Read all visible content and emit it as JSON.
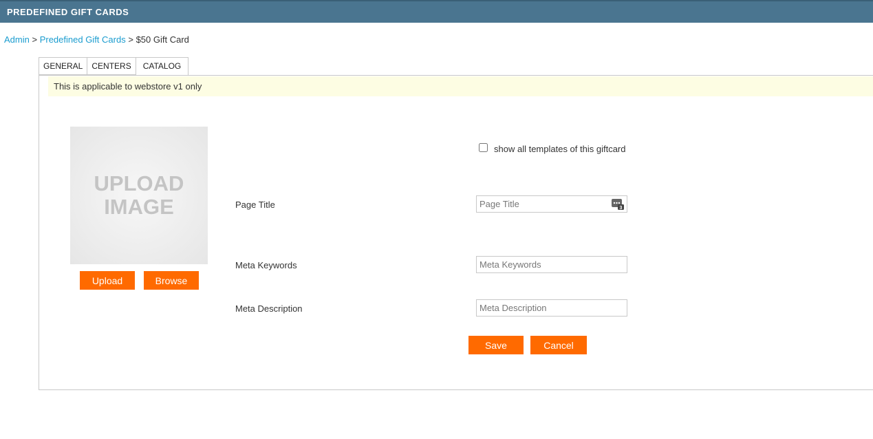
{
  "header": {
    "title": "PREDEFINED GIFT CARDS",
    "color": "#4a7590"
  },
  "breadcrumb": {
    "items": [
      "Admin",
      "Predefined Gift Cards"
    ],
    "separator": ">",
    "current": "$50 Gift Card"
  },
  "tabs": [
    {
      "label": "GENERAL",
      "active": false
    },
    {
      "label": "CENTERS",
      "active": false
    },
    {
      "label": "CATALOG",
      "active": true
    }
  ],
  "notice": "This is applicable to webstore v1 only",
  "upload": {
    "placeholder_line1": "UPLOAD",
    "placeholder_line2": "IMAGE",
    "upload_label": "Upload",
    "browse_label": "Browse"
  },
  "form": {
    "show_templates_label": "show all templates of this giftcard",
    "show_templates_checked": false,
    "page_title_label": "Page Title",
    "page_title_placeholder": "Page Title",
    "page_title_icon": "text-expand-icon",
    "meta_keywords_label": "Meta Keywords",
    "meta_keywords_placeholder": "Meta Keywords",
    "meta_description_label": "Meta Description",
    "meta_description_placeholder": "Meta Description",
    "save_label": "Save",
    "cancel_label": "Cancel"
  },
  "colors": {
    "accent": "#ff6a00",
    "link": "#1a9ccf",
    "notice_bg": "#fdfde3"
  }
}
